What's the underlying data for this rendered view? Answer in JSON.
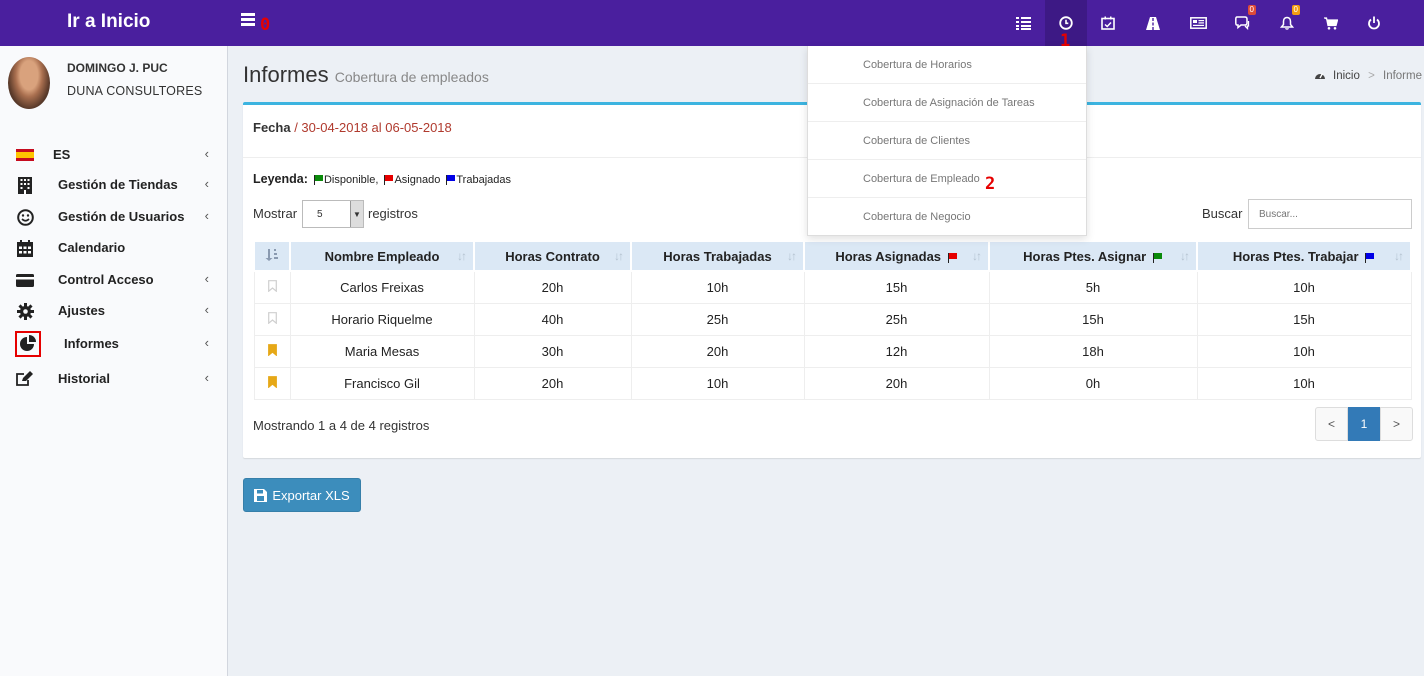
{
  "topbar": {
    "logo": "Ir a Inicio",
    "annotations": {
      "menu": "0",
      "clock": "1",
      "empleado": "2"
    },
    "badges": {
      "chat": "0",
      "bell": "0"
    },
    "icons": [
      "list-icon",
      "clock-icon",
      "calendar-check-icon",
      "road-icon",
      "newspaper-icon",
      "chat-icon",
      "bell-icon",
      "cart-icon",
      "power-icon"
    ]
  },
  "user": {
    "name": "DOMINGO J. PUC",
    "company": "DUNA CONSULTORES"
  },
  "sidebar": {
    "items": [
      {
        "label": "ES",
        "icon": "spain-flag-icon"
      },
      {
        "label": "Gestión de Tiendas",
        "icon": "building-icon"
      },
      {
        "label": "Gestión de Usuarios",
        "icon": "smile-icon"
      },
      {
        "label": "Calendario",
        "icon": "calendar-icon"
      },
      {
        "label": "Control Acceso",
        "icon": "credit-card-icon"
      },
      {
        "label": "Ajustes",
        "icon": "gear-icon"
      },
      {
        "label": "Informes",
        "icon": "pie-chart-icon"
      },
      {
        "label": "Historial",
        "icon": "edit-icon"
      }
    ]
  },
  "page": {
    "title": "Informes",
    "subtitle": "Cobertura de empleados",
    "breadcrumb": {
      "home": "Inicio",
      "sep": ">",
      "current": "Informe"
    }
  },
  "filters": {
    "fecha_label": "Fecha",
    "fecha_sep": " / ",
    "fecha_value": "30-04-2018 al 06-05-2018",
    "leyenda_label": "Leyenda",
    "leyenda_colon": ":",
    "leyenda": [
      {
        "label": "Disponible,",
        "color": "#0a8a0a"
      },
      {
        "label": "Asignado",
        "color": "#e60000"
      },
      {
        "label": "Trabajadas",
        "color": "#0000e6"
      }
    ],
    "mostrar": "Mostrar",
    "page_size": "5",
    "registros": "registros",
    "buscar": "Buscar",
    "buscar_placeholder": "Buscar..."
  },
  "table": {
    "headers": [
      "Nombre Empleado",
      "Horas Contrato",
      "Horas Trabajadas",
      "Horas Asignadas",
      "Horas Ptes. Asignar",
      "Horas Ptes. Trabajar"
    ],
    "header_flags": [
      null,
      null,
      null,
      "#e60000",
      "#0a8a0a",
      "#0000e6"
    ],
    "rows": [
      {
        "bookmarked": false,
        "cells": [
          "Carlos Freixas",
          "20h",
          "10h",
          "15h",
          "5h",
          "10h"
        ]
      },
      {
        "bookmarked": false,
        "cells": [
          "Horario Riquelme",
          "40h",
          "25h",
          "25h",
          "15h",
          "15h"
        ]
      },
      {
        "bookmarked": true,
        "cells": [
          "Maria Mesas",
          "30h",
          "20h",
          "12h",
          "18h",
          "10h"
        ]
      },
      {
        "bookmarked": true,
        "cells": [
          "Francisco Gil",
          "20h",
          "10h",
          "20h",
          "0h",
          "10h"
        ]
      }
    ],
    "footer": "Mostrando 1 a 4 de 4 registros",
    "pager": {
      "prev": "<",
      "current": "1",
      "next": ">"
    }
  },
  "export_button": "Exportar XLS",
  "dropdown": {
    "items": [
      "Cobertura de Horarios",
      "Cobertura de Asignación de Tareas",
      "Cobertura de Clientes",
      "Cobertura de Empleado",
      "Cobertura de Negocio"
    ]
  },
  "colors": {
    "topbar": "#4a1f9e",
    "accent": "#3cb4e0",
    "button": "#3c8dbc",
    "date": "#b03a2e",
    "bookmark": "#e6a817"
  }
}
